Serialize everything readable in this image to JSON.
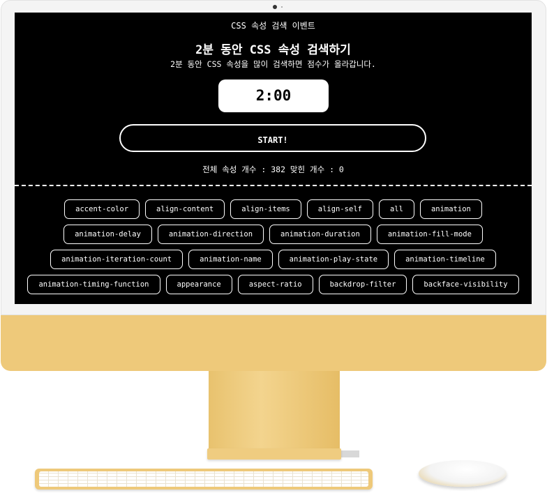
{
  "event": {
    "header": "CSS 속성 검색 이벤트",
    "title": "2분 동안 CSS 속성 검색하기",
    "subtitle": "2분 동안 CSS 속성을 많이 검색하면 점수가 올라갑니다.",
    "timer": "2:00",
    "start_label": "START!",
    "stats": "전체 속성 개수 : 382 맞힌 개수 : 0"
  },
  "properties": [
    [
      "accent-color",
      "align-content",
      "align-items",
      "align-self",
      "all",
      "animation"
    ],
    [
      "animation-delay",
      "animation-direction",
      "animation-duration",
      "animation-fill-mode"
    ],
    [
      "animation-iteration-count",
      "animation-name",
      "animation-play-state",
      "animation-timeline"
    ],
    [
      "animation-timing-function",
      "appearance",
      "aspect-ratio",
      "backdrop-filter",
      "backface-visibility"
    ]
  ],
  "colors": {
    "screen_bg": "#000000",
    "text": "#ffffff",
    "monitor_chin": "#eec97a",
    "bezel": "#f4f4f4"
  }
}
